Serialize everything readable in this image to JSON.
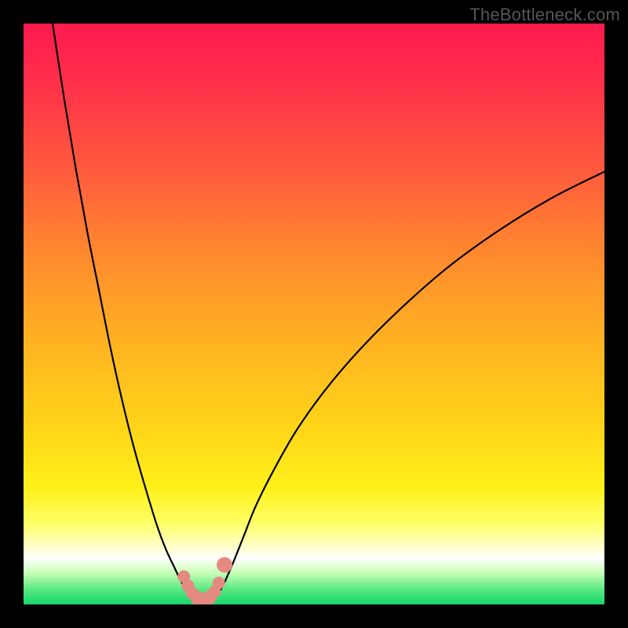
{
  "watermark": "TheBottleneck.com",
  "colors": {
    "frame": "#000000",
    "gradient_stops": [
      {
        "offset": 0.0,
        "color": "#ff1a4f"
      },
      {
        "offset": 0.1,
        "color": "#ff2f4a"
      },
      {
        "offset": 0.25,
        "color": "#ff5a3d"
      },
      {
        "offset": 0.4,
        "color": "#ff8a2e"
      },
      {
        "offset": 0.55,
        "color": "#ffb321"
      },
      {
        "offset": 0.7,
        "color": "#ffd618"
      },
      {
        "offset": 0.8,
        "color": "#fff11a"
      },
      {
        "offset": 0.86,
        "color": "#ffff66"
      },
      {
        "offset": 0.905,
        "color": "#ffffd6"
      },
      {
        "offset": 0.92,
        "color": "#ffffff"
      },
      {
        "offset": 0.945,
        "color": "#c9ffb8"
      },
      {
        "offset": 0.975,
        "color": "#56e87f"
      },
      {
        "offset": 1.0,
        "color": "#17d66c"
      }
    ],
    "curve": "#000000",
    "marker_fill": "#e58a81",
    "marker_stroke": "#c46a60"
  },
  "chart_data": {
    "type": "line",
    "title": "",
    "xlabel": "",
    "ylabel": "",
    "xlim": [
      0,
      100
    ],
    "ylim": [
      0,
      100
    ],
    "grid": false,
    "legend": false,
    "series": [
      {
        "name": "left-branch",
        "x": [
          5,
          7,
          9,
          11,
          13,
          15,
          17,
          19,
          21,
          23,
          24.5,
          26,
          27,
          27.8,
          28.5
        ],
        "y": [
          100,
          87,
          75,
          64,
          54,
          44,
          35,
          27,
          20,
          13.5,
          9.5,
          6.3,
          4.2,
          2.8,
          1.8
        ]
      },
      {
        "name": "right-branch",
        "x": [
          33.5,
          34.5,
          36,
          38,
          40,
          43,
          47,
          52,
          58,
          65,
          73,
          82,
          91,
          100
        ],
        "y": [
          1.8,
          3.6,
          7.0,
          12,
          17,
          23,
          30,
          37,
          44,
          51,
          58,
          64.5,
          70,
          74.5
        ]
      },
      {
        "name": "valley-floor",
        "x": [
          28.5,
          29.5,
          30.5,
          31.5,
          32.5,
          33.5
        ],
        "y": [
          1.8,
          0.9,
          0.5,
          0.5,
          0.9,
          1.8
        ]
      }
    ],
    "markers": {
      "name": "valley-markers",
      "x": [
        27.6,
        28.3,
        29.0,
        29.9,
        31.1,
        32.0,
        32.9,
        33.6,
        34.6
      ],
      "y": [
        4.8,
        3.2,
        2.0,
        1.1,
        0.8,
        1.2,
        2.2,
        3.7,
        6.8
      ],
      "r": [
        8,
        8,
        8,
        9,
        9,
        9,
        8,
        8,
        10
      ]
    }
  }
}
